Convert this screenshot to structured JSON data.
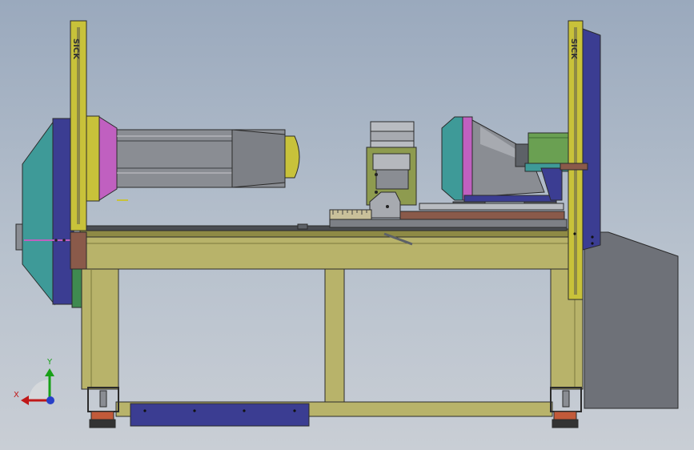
{
  "scene": {
    "left_curtain_label": "SICK",
    "right_curtain_label": "SICK",
    "axis_x_label": "X",
    "axis_y_label": "Y"
  },
  "colors": {
    "frame": "#b8b36a",
    "frame_dark": "#8e8a45",
    "curtain": "#c8c23a",
    "teal": "#3e9a98",
    "navy": "#3b3d92",
    "magenta": "#c060c0",
    "gray": "#8a8d93",
    "dark_gray": "#5d6167",
    "olive": "#8e9b4f",
    "brown": "#8a5a4a"
  }
}
